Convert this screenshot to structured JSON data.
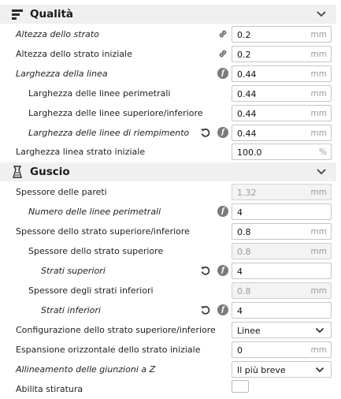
{
  "categories": {
    "quality": {
      "title": "Qualità",
      "icon": "quality-bars-icon"
    },
    "shell": {
      "title": "Guscio",
      "icon": "shell-icon"
    }
  },
  "quality_rows": [
    {
      "label": "Altezza dello strato",
      "italic": true,
      "value": "0.2",
      "unit": "mm",
      "icons": [
        "link-icon"
      ]
    },
    {
      "label": "Altezza dello strato iniziale",
      "italic": false,
      "value": "0.2",
      "unit": "mm",
      "icons": [
        "link-icon"
      ]
    },
    {
      "label": "Larghezza della linea",
      "italic": true,
      "value": "0.44",
      "unit": "mm",
      "icons": [
        "function-icon"
      ]
    },
    {
      "label": "Larghezza delle linee perimetrali",
      "italic": false,
      "value": "0.44",
      "unit": "mm",
      "icons": []
    },
    {
      "label": "Larghezza delle linee superiore/inferiore",
      "italic": false,
      "value": "0.44",
      "unit": "mm",
      "icons": []
    },
    {
      "label": "Larghezza delle linee di riempimento",
      "italic": true,
      "value": "0.44",
      "unit": "mm",
      "icons": [
        "reset-icon",
        "function-icon"
      ]
    },
    {
      "label": "Larghezza linea strato iniziale",
      "italic": false,
      "value": "100.0",
      "unit": "%",
      "icons": []
    }
  ],
  "shell_rows": [
    {
      "label": "Spessore delle pareti",
      "italic": false,
      "value": "1.32",
      "unit": "mm",
      "disabled": true,
      "icons": []
    },
    {
      "label": "Numero delle linee perimetrali",
      "italic": true,
      "value": "4",
      "unit": "",
      "icons": [
        "function-icon"
      ]
    },
    {
      "label": "Spessore dello strato superiore/inferiore",
      "italic": false,
      "value": "0.8",
      "unit": "mm",
      "icons": []
    },
    {
      "label": "Spessore dello strato superiore",
      "italic": false,
      "value": "0.8",
      "unit": "mm",
      "disabled": true,
      "icons": []
    },
    {
      "label": "Strati superiori",
      "italic": true,
      "value": "4",
      "unit": "",
      "icons": [
        "reset-icon",
        "function-icon"
      ]
    },
    {
      "label": "Spessore degli strati inferiori",
      "italic": false,
      "value": "0.8",
      "unit": "mm",
      "disabled": true,
      "icons": []
    },
    {
      "label": "Strati inferiori",
      "italic": true,
      "value": "4",
      "unit": "",
      "icons": [
        "reset-icon",
        "function-icon"
      ]
    },
    {
      "label": "Configurazione dello strato superiore/inferiore",
      "italic": false,
      "value": "Linee",
      "unit": "",
      "select": true,
      "icons": []
    },
    {
      "label": "Espansione orizzontale dello strato iniziale",
      "italic": false,
      "value": "0",
      "unit": "mm",
      "icons": []
    },
    {
      "label": "Allineamento delle giunzioni a Z",
      "italic": true,
      "value": "Il più breve",
      "unit": "",
      "select": true,
      "icons": []
    },
    {
      "label": "Abilita stiratura",
      "italic": false,
      "value": "",
      "unit": "",
      "checkbox": true,
      "icons": []
    }
  ],
  "colors": {
    "header_bg": "#f0f0f0",
    "icon_gray": "#6b6b6b",
    "field_border": "#c6c6c6"
  }
}
